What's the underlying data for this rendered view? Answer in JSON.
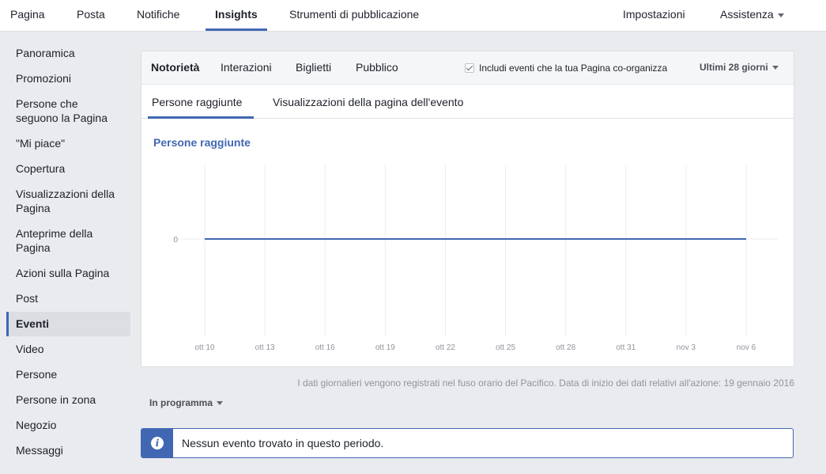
{
  "topnav": {
    "left_tabs": [
      "Pagina",
      "Posta",
      "Notifiche",
      "Insights",
      "Strumenti di pubblicazione"
    ],
    "active": "Insights",
    "settings": "Impostazioni",
    "help": "Assistenza"
  },
  "sidebar": {
    "items": [
      "Panoramica",
      "Promozioni",
      "Persone che seguono la Pagina",
      "\"Mi piace\"",
      "Copertura",
      "Visualizzazioni della Pagina",
      "Anteprime della Pagina",
      "Azioni sulla Pagina",
      "Post",
      "Eventi",
      "Video",
      "Persone",
      "Persone in zona",
      "Negozio",
      "Messaggi"
    ],
    "active": "Eventi"
  },
  "card": {
    "tabs": [
      "Notorietà",
      "Interazioni",
      "Biglietti",
      "Pubblico"
    ],
    "active_tab": "Notorietà",
    "checkbox_label": "Includi eventi che la tua Pagina co-organizza",
    "checkbox_checked": true,
    "range": "Ultimi 28 giorni",
    "view_tabs": [
      "Persone raggiunte",
      "Visualizzazioni della pagina dell'evento"
    ],
    "active_view_tab": "Persone raggiunte"
  },
  "chart_data": {
    "type": "line",
    "title": "Persone raggiunte",
    "categories": [
      "ott 10",
      "ott 13",
      "ott 16",
      "ott 19",
      "ott 22",
      "ott 25",
      "ott 28",
      "ott 31",
      "nov 3",
      "nov 6"
    ],
    "y_tick_labels": [
      "0"
    ],
    "series": [
      {
        "values": [
          0,
          0,
          0,
          0,
          0,
          0,
          0,
          0,
          0,
          0
        ]
      }
    ],
    "series_color": "#4267b2",
    "grid": true
  },
  "footnote": "I dati giornalieri vengono registrati nel fuso orario del Pacifico. Data di inizio dei dati relativi all'azione: 19 gennaio 2016",
  "schedule_dropdown": "In programma",
  "notice": "Nessun evento trovato in questo periodo.",
  "colors": {
    "accent": "#4267b2",
    "background": "#e9ebee"
  },
  "icons": {
    "notice": "info-icon",
    "checkbox": "checkmark-icon",
    "dropdown": "caret-down-icon"
  }
}
